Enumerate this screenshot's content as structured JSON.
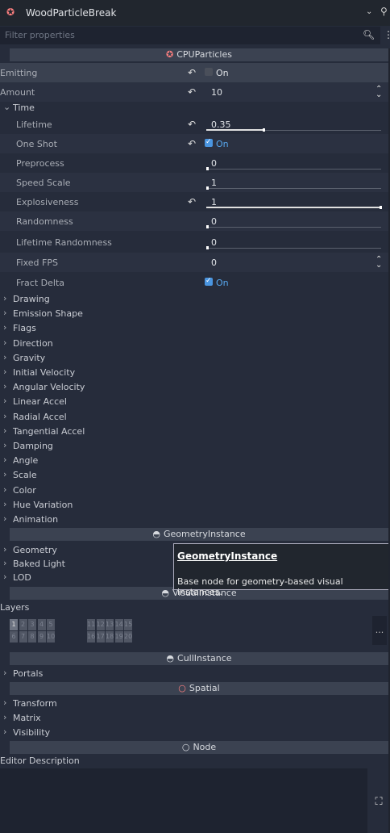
{
  "header": {
    "title": "WoodParticleBreak",
    "filter_placeholder": "Filter properties"
  },
  "sections": {
    "cpu": "CPUParticles",
    "geometry": "GeometryInstance",
    "visual": "VisualInstance",
    "cull": "CullInstance",
    "spatial": "Spatial",
    "node": "Node"
  },
  "props": {
    "emitting": {
      "label": "Emitting",
      "value": "On",
      "checked": false
    },
    "amount": {
      "label": "Amount",
      "value": "10"
    },
    "time_group": "Time",
    "lifetime": {
      "label": "Lifetime",
      "value": "0.35",
      "level": 0.33
    },
    "one_shot": {
      "label": "One Shot",
      "value": "On",
      "checked": true
    },
    "preprocess": {
      "label": "Preprocess",
      "value": "0",
      "level": 0
    },
    "speed_scale": {
      "label": "Speed Scale",
      "value": "1",
      "level": 0.01
    },
    "explosiveness": {
      "label": "Explosiveness",
      "value": "1",
      "level": 1
    },
    "randomness": {
      "label": "Randomness",
      "value": "0",
      "level": 0
    },
    "lifetime_randomness": {
      "label": "Lifetime Randomness",
      "value": "0",
      "level": 0
    },
    "fixed_fps": {
      "label": "Fixed FPS",
      "value": "0"
    },
    "fract_delta": {
      "label": "Fract Delta",
      "value": "On",
      "checked": true
    }
  },
  "cpu_groups": [
    "Drawing",
    "Emission Shape",
    "Flags",
    "Direction",
    "Gravity",
    "Initial Velocity",
    "Angular Velocity",
    "Linear Accel",
    "Radial Accel",
    "Tangential Accel",
    "Damping",
    "Angle",
    "Scale",
    "Color",
    "Hue Variation",
    "Animation"
  ],
  "geometry_groups": [
    "Geometry",
    "Baked Light",
    "LOD"
  ],
  "tooltip": {
    "title": "GeometryInstance",
    "description": "Base node for geometry-based visual instances."
  },
  "layers": {
    "label": "Layers",
    "cells": [
      "1",
      "2",
      "3",
      "4",
      "5",
      "11",
      "12",
      "13",
      "14",
      "15",
      "6",
      "7",
      "8",
      "9",
      "10",
      "16",
      "17",
      "18",
      "19",
      "20"
    ],
    "more": "..."
  },
  "cull_groups": [
    "Portals"
  ],
  "spatial_groups": [
    "Transform",
    "Matrix",
    "Visibility"
  ],
  "editor_description_label": "Editor Description",
  "colors": {
    "accent": "#57a7ee",
    "section_bg": "#3b4251",
    "node_red": "#fc7f7f"
  }
}
